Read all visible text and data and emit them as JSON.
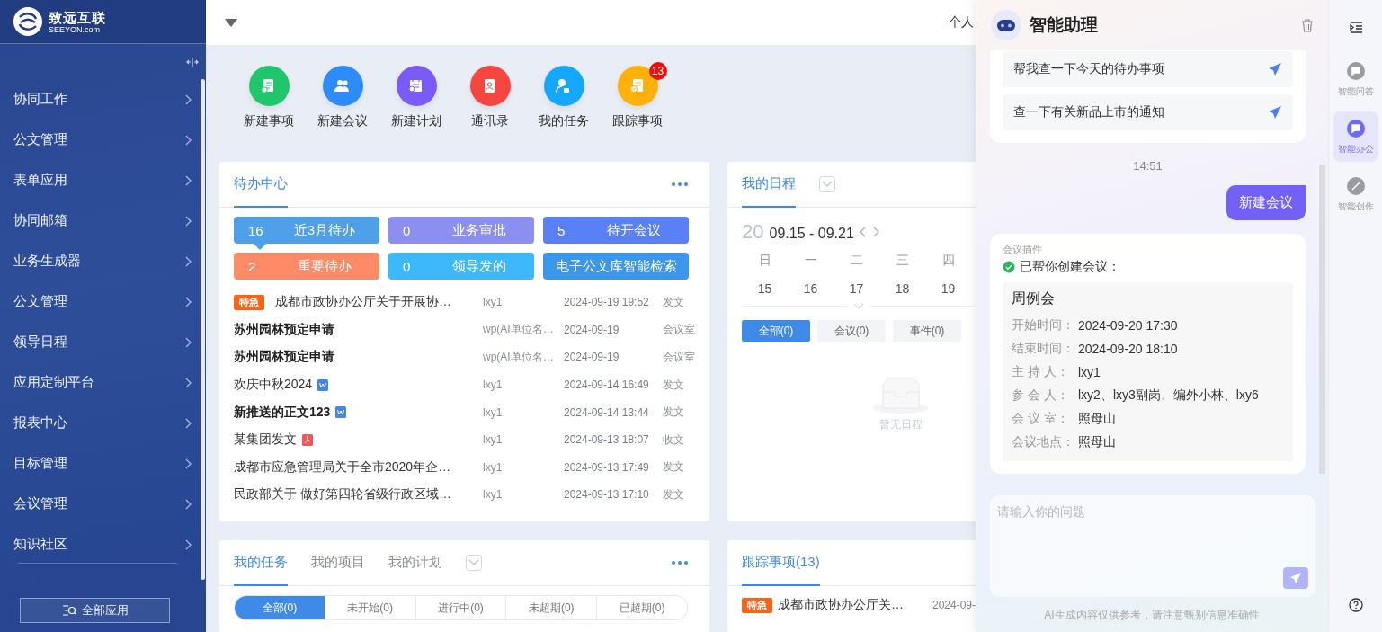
{
  "sidebar": {
    "logo_name": "致远互联",
    "logo_domain": "SEEYON.com",
    "all_apps": "全部应用",
    "items": [
      {
        "label": "协同工作"
      },
      {
        "label": "公文管理"
      },
      {
        "label": "表单应用"
      },
      {
        "label": "协同邮箱"
      },
      {
        "label": "业务生成器"
      },
      {
        "label": "公文管理"
      },
      {
        "label": "领导日程"
      },
      {
        "label": "应用定制平台"
      },
      {
        "label": "报表中心"
      },
      {
        "label": "目标管理"
      },
      {
        "label": "会议管理"
      },
      {
        "label": "知识社区"
      }
    ]
  },
  "topbar": {
    "tab": "个人"
  },
  "quick_actions": [
    {
      "label": "新建事项",
      "kind": "doc",
      "color": "#1fc66b"
    },
    {
      "label": "新建会议",
      "kind": "people",
      "color": "#2d8cf8"
    },
    {
      "label": "新建计划",
      "kind": "plan",
      "color": "#7a5af8"
    },
    {
      "label": "通讯录",
      "kind": "contacts",
      "color": "#f5473f"
    },
    {
      "label": "我的任务",
      "kind": "person",
      "color": "#14a7fb"
    },
    {
      "label": "跟踪事项",
      "kind": "track",
      "color": "#fdb10a",
      "badge": "13"
    }
  ],
  "todo_card": {
    "tab": "待办中心",
    "tiles": [
      {
        "count": "16",
        "label": "近3月待办",
        "color": "#4f9fe9",
        "selected": true
      },
      {
        "count": "0",
        "label": "业务审批",
        "color": "#8a8ff0",
        "selected": false
      },
      {
        "count": "5",
        "label": "待开会议",
        "color": "#5a80f6",
        "selected": false
      },
      {
        "count": "2",
        "label": "重要待办",
        "color": "#fd8b68",
        "selected": false
      },
      {
        "count": "0",
        "label": "领导发的",
        "color": "#3cb8fb",
        "selected": false
      },
      {
        "label": "电子公文库智能检索",
        "color": "#3c97ec",
        "selected": false
      }
    ],
    "rows": [
      {
        "tag": "特急",
        "title": "成都市政协办公厅关于开展协…",
        "kind": "plain",
        "bold": false,
        "sender": "lxy1",
        "date": "2024-09-19 19:52",
        "type": "发文"
      },
      {
        "title": "苏州园林预定申请",
        "kind": "plain",
        "bold": true,
        "sender": "wp(AI单位名…",
        "date": "2024-09-19",
        "type": "会议室"
      },
      {
        "title": "苏州园林预定申请",
        "kind": "plain",
        "bold": true,
        "sender": "wp(AI单位名…",
        "date": "2024-09-19",
        "type": "会议室"
      },
      {
        "title": "欢庆中秋2024",
        "kind": "word",
        "bold": false,
        "sender": "lxy1",
        "date": "2024-09-14 16:49",
        "type": "发文"
      },
      {
        "title": "新推送的正文123",
        "kind": "word",
        "bold": true,
        "sender": "lxy1",
        "date": "2024-09-14 13:44",
        "type": "发文"
      },
      {
        "title": "某集团发文",
        "kind": "pdf",
        "bold": false,
        "sender": "lxy1",
        "date": "2024-09-13 18:07",
        "type": "收文"
      },
      {
        "title": "成都市应急管理局关于全市2020年企…",
        "kind": "plain",
        "bold": false,
        "sender": "lxy1",
        "date": "2024-09-13 17:49",
        "type": "发文"
      },
      {
        "title": "民政部关于 做好第四轮省级行政区域…",
        "kind": "plain",
        "bold": false,
        "sender": "lxy1",
        "date": "2024-09-13 17:10",
        "type": "发文"
      }
    ]
  },
  "task_card": {
    "tabs": [
      {
        "label": "我的任务",
        "selected": true
      },
      {
        "label": "我的项目",
        "selected": false
      },
      {
        "label": "我的计划",
        "selected": false
      }
    ],
    "filters": [
      {
        "label": "全部(0)",
        "selected": true
      },
      {
        "label": "未开始(0)",
        "selected": false
      },
      {
        "label": "进行中(0)",
        "selected": false
      },
      {
        "label": "未超期(0)",
        "selected": false
      },
      {
        "label": "已超期(0)",
        "selected": false
      }
    ]
  },
  "schedule_card": {
    "tab": "我的日程",
    "year": "20",
    "range": "09.15 - 09.21",
    "weekdays": [
      "日",
      "一",
      "二",
      "三",
      "四"
    ],
    "dates": [
      "15",
      "16",
      "17",
      "18",
      "19"
    ],
    "filters": [
      {
        "label": "全部(0)",
        "selected": true
      },
      {
        "label": "会议(0)",
        "selected": false
      },
      {
        "label": "事件(0)",
        "selected": false
      }
    ],
    "empty_text": "暂无日程"
  },
  "tracking_card": {
    "tab": "跟踪事项(13)",
    "rows": [
      {
        "tag": "特急",
        "title": "成都市政协办公厅关…",
        "date": "2024-09-"
      }
    ]
  },
  "assistant": {
    "title": "智能助理",
    "suggestions": [
      "帮我查一下今天的待办事项",
      "查一下有关新品上市的通知"
    ],
    "time": "14:51",
    "user_message": "新建会议",
    "reply": {
      "plugin": "会议插件",
      "status": "已帮你创建会议：",
      "meeting_title": "周例会",
      "fields": [
        {
          "label": "开始时间：",
          "value": "2024-09-20 17:30"
        },
        {
          "label": "结束时间：",
          "value": "2024-09-20 18:10"
        },
        {
          "label": "主 持 人：",
          "value": "lxy1"
        },
        {
          "label": "参 会 人：",
          "value": "lxy2、lxy3副岗、编外小林、lxy6"
        },
        {
          "label": "会 议 室：",
          "value": "照母山"
        },
        {
          "label": "会议地点：",
          "value": "照母山"
        }
      ]
    },
    "input_placeholder": "请输入你的问题",
    "disclaimer": "AI生成内容仅供参考，请注意甄别信息准确性"
  },
  "rail": {
    "items": [
      {
        "label": "智能问答",
        "selected": false
      },
      {
        "label": "智能办公",
        "selected": true
      },
      {
        "label": "智能创作",
        "selected": false
      }
    ]
  }
}
